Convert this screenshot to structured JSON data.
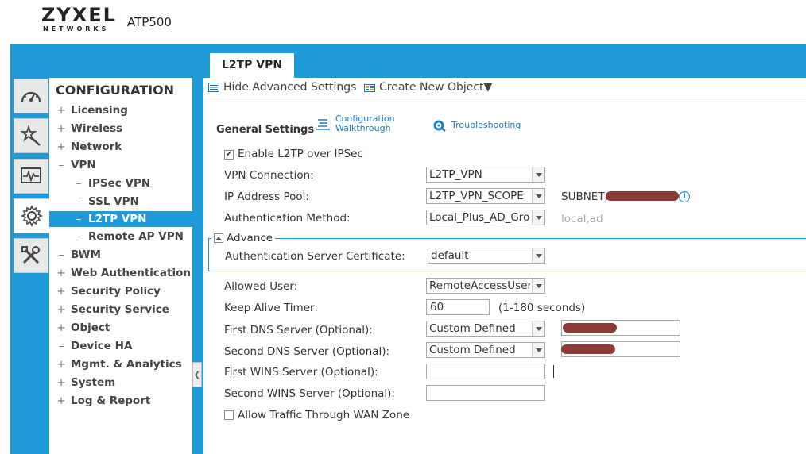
{
  "header": {
    "brand": "ZYXEL",
    "brand_sub": "NETWORKS",
    "model": "ATP500"
  },
  "active_tab": "L2TP VPN",
  "rail": {
    "icons": [
      "dashboard-icon",
      "wizard-icon",
      "monitor-icon",
      "configuration-gear-icon",
      "maintenance-tools-icon"
    ]
  },
  "nav": {
    "title": "CONFIGURATION",
    "items": [
      {
        "sym": "+",
        "label": "Licensing"
      },
      {
        "sym": "+",
        "label": "Wireless"
      },
      {
        "sym": "+",
        "label": "Network"
      },
      {
        "sym": "–",
        "label": "VPN"
      },
      {
        "sym": "–",
        "label": "IPSec VPN"
      },
      {
        "sym": "–",
        "label": "SSL VPN"
      },
      {
        "sym": "–",
        "label": "L2TP VPN"
      },
      {
        "sym": "–",
        "label": "Remote AP VPN"
      },
      {
        "sym": "–",
        "label": "BWM"
      },
      {
        "sym": "+",
        "label": "Web Authentication"
      },
      {
        "sym": "+",
        "label": "Security Policy"
      },
      {
        "sym": "+",
        "label": "Security Service"
      },
      {
        "sym": "+",
        "label": "Object"
      },
      {
        "sym": "–",
        "label": "Device HA"
      },
      {
        "sym": "+",
        "label": "Mgmt. & Analytics"
      },
      {
        "sym": "+",
        "label": "System"
      },
      {
        "sym": "+",
        "label": "Log & Report"
      }
    ]
  },
  "toolbar": {
    "hide_advanced": "Hide Advanced Settings",
    "create_object": "Create New Object▼"
  },
  "general": {
    "title": "General Settings",
    "config_link_1": "Configuration",
    "config_link_2": "Walkthrough",
    "troubleshoot_link": "Troubleshooting"
  },
  "form": {
    "enable_l2tp": {
      "label": "Enable L2TP over IPSec",
      "checked": true
    },
    "vpn_connection": {
      "label": "VPN Connection:",
      "value": "L2TP_VPN"
    },
    "ip_pool": {
      "label": "IP Address Pool:",
      "value": "L2TP_VPN_SCOPE",
      "note": "SUBNET,"
    },
    "auth_method": {
      "label": "Authentication Method:",
      "value": "Local_Plus_AD_Grou",
      "hint": "local,ad"
    },
    "advance_label": "Advance",
    "auth_cert": {
      "label": "Authentication Server Certificate:",
      "value": "default"
    },
    "allowed_user": {
      "label": "Allowed User:",
      "value": "RemoteAccessUsers"
    },
    "keep_alive": {
      "label": "Keep Alive Timer:",
      "value": "60",
      "range": "(1-180 seconds)"
    },
    "dns1": {
      "label": "First DNS Server (Optional):",
      "value": "Custom Defined"
    },
    "dns2": {
      "label": "Second DNS Server (Optional):",
      "value": "Custom Defined"
    },
    "wins1": {
      "label": "First WINS Server (Optional):",
      "value": ""
    },
    "wins2": {
      "label": "Second WINS Server (Optional):",
      "value": ""
    },
    "allow_wan": {
      "label": "Allow Traffic Through WAN Zone",
      "checked": false
    }
  },
  "colors": {
    "accent": "#1e9ad6",
    "redaction": "#8b3a36"
  }
}
